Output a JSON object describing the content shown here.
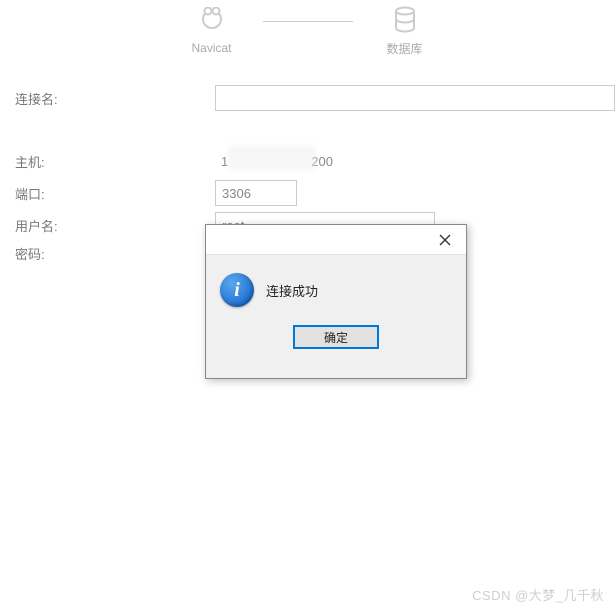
{
  "diagram": {
    "left_label": "Navicat",
    "right_label": "数据库"
  },
  "form": {
    "conn_name_label": "连接名:",
    "conn_name_value": "",
    "host_label": "主机:",
    "host_value": "1                       200",
    "port_label": "端口:",
    "port_value": "3306",
    "user_label": "用户名:",
    "user_value": "root",
    "pass_label": "密码:"
  },
  "dialog": {
    "message": "连接成功",
    "ok_label": "确定"
  },
  "watermark": "CSDN @大梦_几千秋"
}
